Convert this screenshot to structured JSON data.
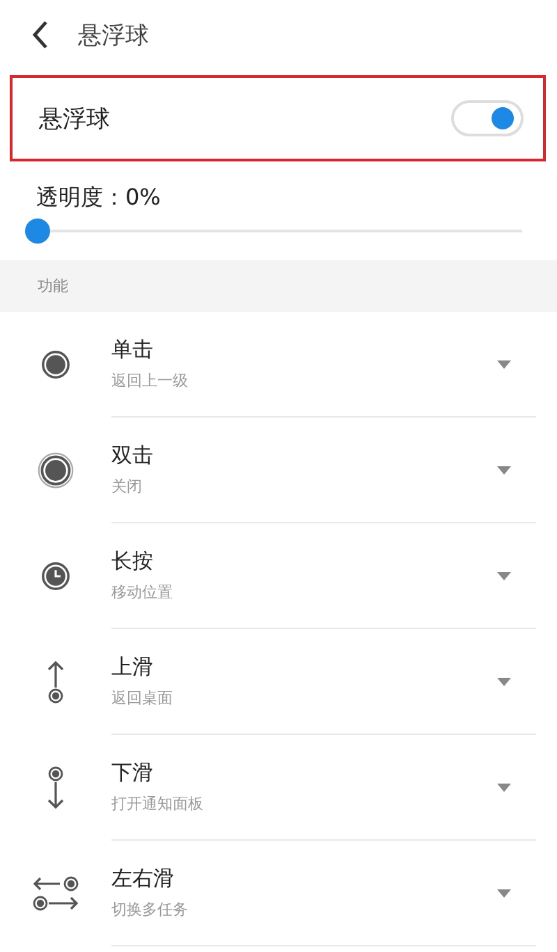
{
  "header": {
    "title": "悬浮球"
  },
  "floating_ball": {
    "label": "悬浮球",
    "on": true,
    "highlighted": true
  },
  "opacity": {
    "label": "透明度：0%",
    "level": 0
  },
  "section": {
    "title": "功能"
  },
  "gestures": [
    {
      "kind": "tap",
      "title": "单击",
      "action": "返回上一级"
    },
    {
      "kind": "double",
      "title": "双击",
      "action": "关闭"
    },
    {
      "kind": "long",
      "title": "长按",
      "action": "移动位置"
    },
    {
      "kind": "up",
      "title": "上滑",
      "action": "返回桌面"
    },
    {
      "kind": "down",
      "title": "下滑",
      "action": "打开通知面板"
    },
    {
      "kind": "leftright",
      "title": "左右滑",
      "action": "切换多任务"
    }
  ]
}
